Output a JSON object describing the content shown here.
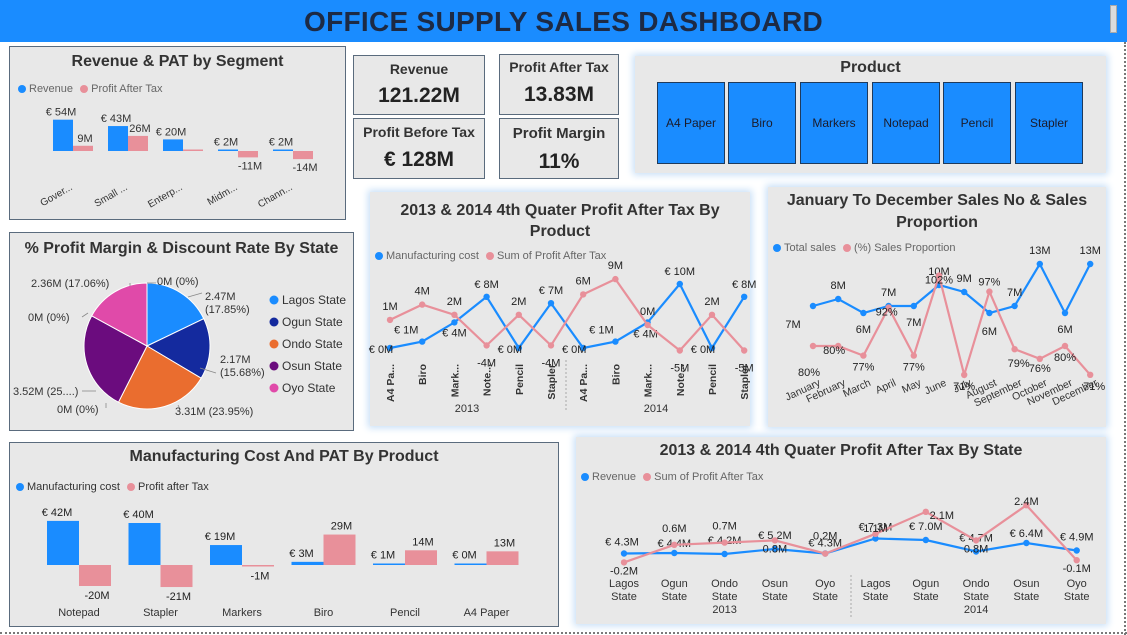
{
  "dashboard": {
    "title": "OFFICE SUPPLY  SALES DASHBOARD"
  },
  "colors": {
    "blue": "#1a8cff",
    "pink": "#e8909a",
    "banner": "#1a8cff",
    "panel": "#e8e8e8",
    "title_text": "#1d2a44"
  },
  "kpis": {
    "revenue": {
      "label": "Revenue",
      "value": "121.22M"
    },
    "profit_after_tax": {
      "label": "Profit After Tax",
      "value": "13.83M"
    },
    "profit_before_tax": {
      "label": "Profit Before Tax",
      "value": "€ 128M"
    },
    "profit_margin": {
      "label": "Profit Margin",
      "value": "11%"
    }
  },
  "product_slicer": {
    "title": "Product",
    "items": [
      "A4 Paper",
      "Biro",
      "Markers",
      "Notepad",
      "Pencil",
      "Stapler"
    ]
  },
  "chart_data": [
    {
      "id": "segment",
      "type": "bar",
      "title": "Revenue & PAT by Segment",
      "categories": [
        "Gover...",
        "Small ...",
        "Enterp...",
        "Midm...",
        "Chann..."
      ],
      "series": [
        {
          "name": "Revenue",
          "color": "#1a8cff",
          "values": [
            54,
            43,
            20,
            2,
            2
          ],
          "labels": [
            "€ 54M",
            "€ 43M",
            "€ 20M",
            "€ 2M",
            "€ 2M"
          ]
        },
        {
          "name": "Profit After Tax",
          "color": "#e8909a",
          "values": [
            9,
            26,
            1,
            -11,
            -14
          ],
          "labels": [
            "9M",
            "26M",
            "",
            "-11M",
            "-14M"
          ]
        }
      ]
    },
    {
      "id": "state_pie",
      "type": "pie",
      "title": "% Profit Margin & Discount Rate By State",
      "slices": [
        {
          "name": "Lagos State",
          "value": 17.85,
          "color": "#1a8cff"
        },
        {
          "name": "Ogun State",
          "value": 15.68,
          "color": "#142a9e"
        },
        {
          "name": "Ondo State",
          "value": 23.95,
          "color": "#ea6d2f"
        },
        {
          "name": "Osun State",
          "value": 25.46,
          "color": "#6b0c7e"
        },
        {
          "name": "Oyo State",
          "value": 17.06,
          "color": "#e04aa9"
        }
      ],
      "labels": [
        {
          "line1": "2.47M",
          "line2": "(17.85%)"
        },
        {
          "line1": "2.17M",
          "line2": "(15.68%)"
        },
        {
          "line1": "3.31M (23.95%)",
          "line2": ""
        },
        {
          "line1": "3.52M (25....)",
          "line2": ""
        },
        {
          "line1": "2.36M (17.06%)",
          "line2": ""
        },
        {
          "line1": "0M (0%)",
          "line2": ""
        },
        {
          "line1": "0M (0%)",
          "line2": ""
        },
        {
          "line1": "0M (0%)",
          "line2": ""
        }
      ]
    },
    {
      "id": "q4_product",
      "type": "line",
      "title": "2013 & 2014 4th Quater Profit After Tax By Product",
      "categories": [
        "A4 Pa...",
        "Biro",
        "Mark...",
        "Note...",
        "Pencil",
        "Stapler",
        "A4 Pa...",
        "Biro",
        "Mark...",
        "Note...",
        "Pencil",
        "Stapler"
      ],
      "groups": [
        "2013",
        "2014"
      ],
      "series": [
        {
          "name": "Manufacturing cost",
          "color": "#1a8cff",
          "values": [
            0,
            1,
            4,
            8,
            0,
            7,
            0,
            1,
            4,
            10,
            0,
            8
          ],
          "labels": [
            "€ 0M",
            "€ 1M",
            "€ 4M",
            "€ 8M",
            "€ 0M",
            "€ 7M",
            "€ 0M",
            "€ 1M",
            "€ 4M",
            "€ 10M",
            "€ 0M",
            "€ 8M"
          ]
        },
        {
          "name": "Sum of Profit After Tax",
          "color": "#e8909a",
          "values": [
            1,
            4,
            2,
            -4,
            2,
            -4,
            6,
            9,
            0,
            -5,
            2,
            -5
          ],
          "labels": [
            "1M",
            "4M",
            "2M",
            "-4M",
            "2M",
            "-4M",
            "6M",
            "9M",
            "0M",
            "-5M",
            "2M",
            "-5M"
          ]
        }
      ]
    },
    {
      "id": "monthly",
      "type": "line",
      "title": "January To December Sales No & Sales Proportion",
      "categories": [
        "January",
        "February",
        "March",
        "April",
        "May",
        "June",
        "July",
        "August",
        "September",
        "October",
        "November",
        "December"
      ],
      "series": [
        {
          "name": "Total sales",
          "color": "#1a8cff",
          "values": [
            7,
            8,
            6,
            7,
            7,
            10,
            9,
            6,
            7,
            13,
            6,
            13
          ],
          "labels": [
            "7M",
            "8M",
            "6M",
            "7M",
            "7M",
            "10M",
            "9M",
            "6M",
            "7M",
            "13M",
            "6M",
            "13M"
          ]
        },
        {
          "name": "(%) Sales Proportion",
          "color": "#e8909a",
          "values": [
            80,
            80,
            77,
            92,
            77,
            102,
            71,
            97,
            79,
            76,
            80,
            71
          ],
          "labels": [
            "80%",
            "80%",
            "77%",
            "92%",
            "77%",
            "102%",
            "71%",
            "97%",
            "79%",
            "76%",
            "80%",
            "71%"
          ]
        }
      ]
    },
    {
      "id": "mfg_pat",
      "type": "bar",
      "title": "Manufacturing Cost And PAT By Product",
      "categories": [
        "Notepad",
        "Stapler",
        "Markers",
        "Biro",
        "Pencil",
        "A4 Paper"
      ],
      "series": [
        {
          "name": "Manufacturing cost",
          "color": "#1a8cff",
          "values": [
            42,
            40,
            19,
            3,
            1,
            0
          ],
          "labels": [
            "€ 42M",
            "€ 40M",
            "€ 19M",
            "€ 3M",
            "€ 1M",
            "€ 0M"
          ]
        },
        {
          "name": "Profit after Tax",
          "color": "#e8909a",
          "values": [
            -20,
            -21,
            -1,
            29,
            14,
            13
          ],
          "labels": [
            "-20M",
            "-21M",
            "-1M",
            "29M",
            "14M",
            "13M"
          ]
        }
      ]
    },
    {
      "id": "q4_state",
      "type": "line",
      "title": "2013 & 2014 4th Quater Profit After Tax By State",
      "categories": [
        "Lagos State",
        "Ogun State",
        "Ondo State",
        "Osun State",
        "Oyo State",
        "Lagos State",
        "Ogun State",
        "Ondo State",
        "Osun State",
        "Oyo State"
      ],
      "groups": [
        "2013",
        "2014"
      ],
      "series": [
        {
          "name": "Revenue",
          "color": "#1a8cff",
          "values": [
            4.3,
            4.4,
            4.2,
            5.2,
            4.3,
            7.3,
            7.0,
            4.7,
            6.4,
            4.9
          ],
          "labels": [
            "€ 4.3M",
            "€ 4.4M",
            "€ 4.2M",
            "€ 5.2M",
            "€ 4.3M",
            "€ 7.3M",
            "€ 7.0M",
            "€ 4.7M",
            "€ 6.4M",
            "€ 4.9M"
          ]
        },
        {
          "name": "Sum of Profit After Tax",
          "color": "#e8909a",
          "values": [
            -0.2,
            0.6,
            0.7,
            0.8,
            0.2,
            1.1,
            2.1,
            0.8,
            2.4,
            -0.1
          ],
          "labels": [
            "-0.2M",
            "0.6M",
            "0.7M",
            "0.8M",
            "0.2M",
            "1.1M",
            "2.1M",
            "0.8M",
            "2.4M",
            "-0.1M"
          ]
        }
      ]
    }
  ]
}
